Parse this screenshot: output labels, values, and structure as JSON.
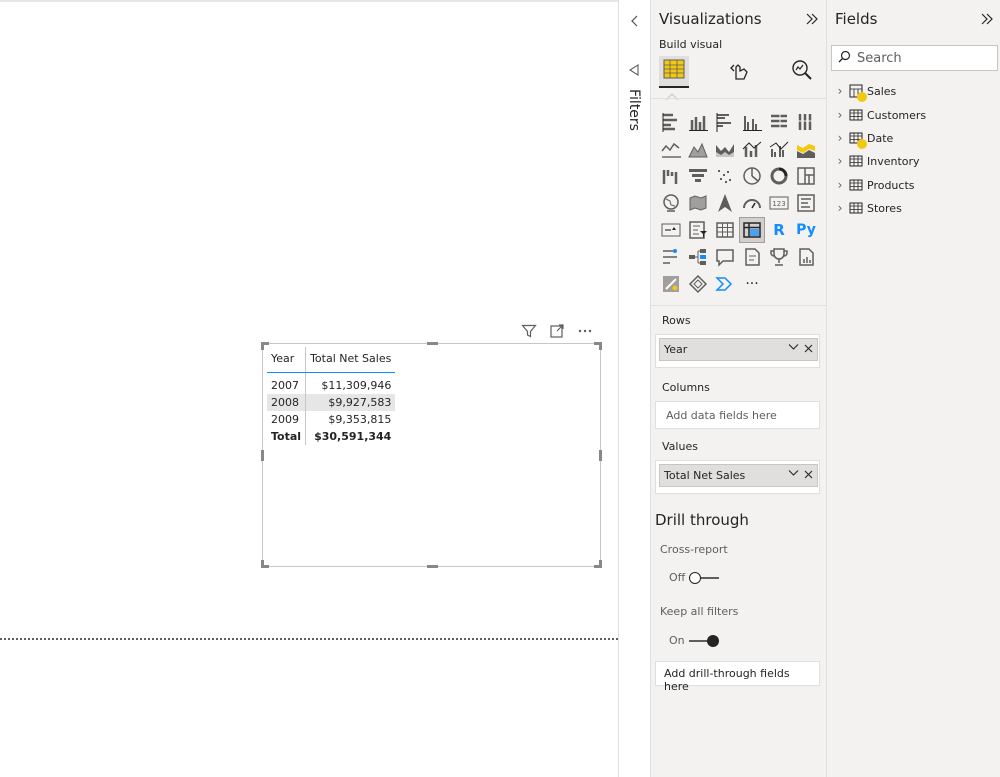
{
  "visual": {
    "columns": [
      "Year",
      "Total Net Sales"
    ],
    "rows": [
      {
        "year": "2007",
        "value": "$11,309,946"
      },
      {
        "year": "2008",
        "value": "$9,927,583"
      },
      {
        "year": "2009",
        "value": "$9,353,815"
      }
    ],
    "total": {
      "label": "Total",
      "value": "$30,591,344"
    },
    "header_icons": [
      "filter-icon",
      "focus-mode-icon",
      "more-options-icon"
    ]
  },
  "filters": {
    "label": "Filters"
  },
  "visualizations": {
    "title": "Visualizations",
    "build_label": "Build visual",
    "modes": [
      "build-visual-icon",
      "format-visual-icon",
      "analytics-icon"
    ],
    "gallery": [
      "stacked-bar-chart-icon",
      "stacked-column-chart-icon",
      "clustered-bar-chart-icon",
      "clustered-column-chart-icon",
      "100-stacked-bar-chart-icon",
      "100-stacked-column-chart-icon",
      "line-chart-icon",
      "area-chart-icon",
      "stacked-area-chart-icon",
      "line-and-stacked-column-icon",
      "line-and-clustered-column-icon",
      "ribbon-chart-icon",
      "waterfall-chart-icon",
      "funnel-icon",
      "scatter-chart-icon",
      "pie-chart-icon",
      "donut-chart-icon",
      "treemap-icon",
      "map-icon",
      "filled-map-icon",
      "azure-map-icon",
      "gauge-icon",
      "card-icon",
      "multi-row-card-icon",
      "kpi-icon",
      "slicer-icon",
      "table-icon",
      "matrix-icon",
      "r-visual-icon",
      "python-visual-icon",
      "key-influencers-icon",
      "decomposition-tree-icon",
      "qa-icon",
      "smart-narrative-icon",
      "metrics-icon",
      "paginated-report-icon",
      "power-apps-icon",
      "power-automate-icon",
      "power-automate-flow-icon",
      "more-visuals-icon"
    ],
    "selected": "matrix-icon",
    "r_label": "R",
    "py_label": "Py",
    "more_label": "···",
    "card_label": "123",
    "wells": {
      "rows_label": "Rows",
      "rows_field": "Year",
      "columns_label": "Columns",
      "columns_placeholder": "Add data fields here",
      "values_label": "Values",
      "values_field": "Total Net Sales"
    },
    "drill": {
      "title": "Drill through",
      "cross_report_label": "Cross-report",
      "cross_report_state": "Off",
      "keep_filters_label": "Keep all filters",
      "keep_filters_state": "On",
      "placeholder": "Add drill-through fields here"
    }
  },
  "fields": {
    "title": "Fields",
    "search_placeholder": "Search",
    "tables": [
      {
        "name": "Sales",
        "checked": true,
        "icon": "calculator-table-icon"
      },
      {
        "name": "Customers",
        "checked": false,
        "icon": "table-icon"
      },
      {
        "name": "Date",
        "checked": true,
        "icon": "table-icon"
      },
      {
        "name": "Inventory",
        "checked": false,
        "icon": "table-icon"
      },
      {
        "name": "Products",
        "checked": false,
        "icon": "table-icon"
      },
      {
        "name": "Stores",
        "checked": false,
        "icon": "table-icon"
      }
    ]
  },
  "colors": {
    "accent": "#118dff",
    "check": "#f2c811",
    "pane_bg": "#f3f2f1",
    "text": "#252423"
  }
}
